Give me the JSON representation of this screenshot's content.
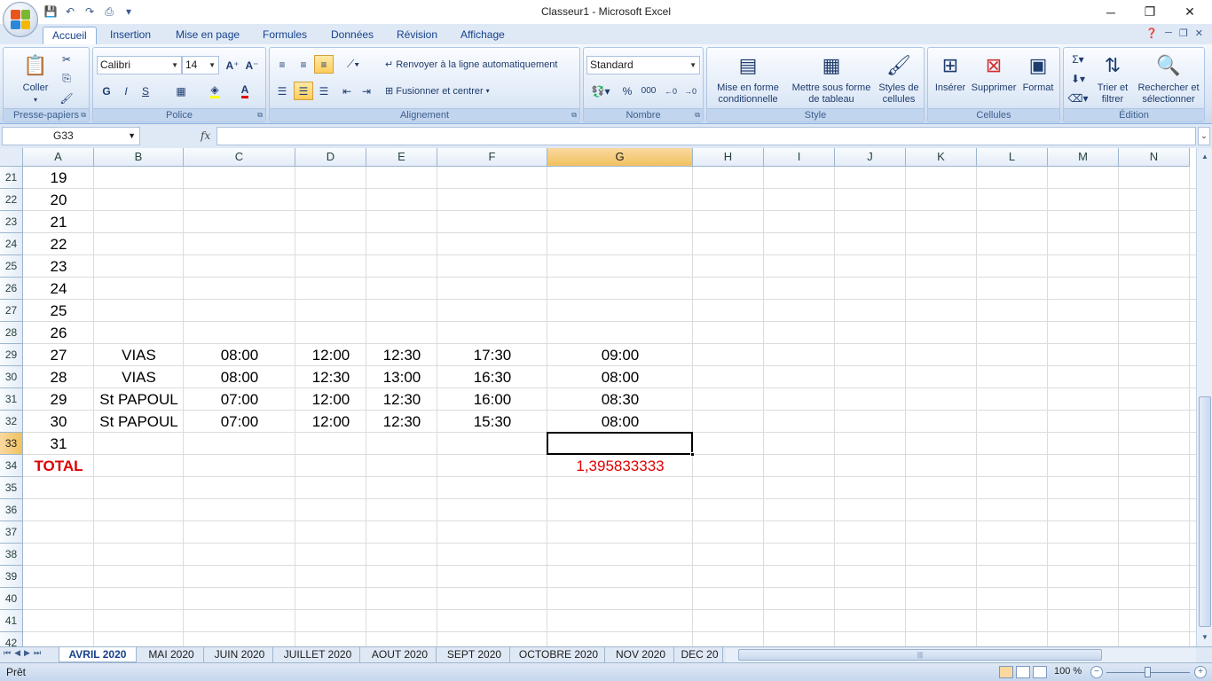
{
  "window": {
    "title": "Classeur1 - Microsoft Excel",
    "minimize": "─",
    "restore": "❐",
    "close": "✕"
  },
  "qat": {
    "icons": [
      "save-icon",
      "undo-icon",
      "redo-icon",
      "print-icon",
      "customize-icon"
    ]
  },
  "tabs": [
    "Accueil",
    "Insertion",
    "Mise en page",
    "Formules",
    "Données",
    "Révision",
    "Affichage"
  ],
  "ribbon": {
    "clipboard": {
      "label": "Presse-papiers",
      "paste": "Coller"
    },
    "font": {
      "label": "Police",
      "name": "Calibri",
      "size": "14",
      "bold": "G",
      "italic": "I",
      "underline": "S"
    },
    "alignment": {
      "label": "Alignement",
      "wrap": "Renvoyer à la ligne automatiquement",
      "merge": "Fusionner et centrer"
    },
    "number": {
      "label": "Nombre",
      "format": "Standard",
      "percent": "%",
      "thousands": "000"
    },
    "style": {
      "label": "Style",
      "conditional": "Mise en forme conditionnelle",
      "table": "Mettre sous forme de tableau",
      "cell_styles": "Styles de cellules"
    },
    "cells": {
      "label": "Cellules",
      "insert": "Insérer",
      "delete": "Supprimer",
      "format": "Format"
    },
    "editing": {
      "label": "Édition",
      "sort": "Trier et filtrer",
      "find": "Rechercher et sélectionner"
    }
  },
  "formula_bar": {
    "name_box": "G33",
    "fx": "fx",
    "formula": ""
  },
  "columns": [
    "A",
    "B",
    "C",
    "D",
    "E",
    "F",
    "G",
    "H",
    "I",
    "J",
    "K",
    "L",
    "M",
    "N"
  ],
  "selected_column": "G",
  "selected_row": "33",
  "rows": [
    {
      "n": "21",
      "A": "19"
    },
    {
      "n": "22",
      "A": "20"
    },
    {
      "n": "23",
      "A": "21"
    },
    {
      "n": "24",
      "A": "22"
    },
    {
      "n": "25",
      "A": "23"
    },
    {
      "n": "26",
      "A": "24"
    },
    {
      "n": "27",
      "A": "25"
    },
    {
      "n": "28",
      "A": "26"
    },
    {
      "n": "29",
      "A": "27",
      "B": "VIAS",
      "C": "08:00",
      "D": "12:00",
      "E": "12:30",
      "F": "17:30",
      "G": "09:00"
    },
    {
      "n": "30",
      "A": "28",
      "B": "VIAS",
      "C": "08:00",
      "D": "12:30",
      "E": "13:00",
      "F": "16:30",
      "G": "08:00"
    },
    {
      "n": "31",
      "A": "29",
      "B": "St PAPOUL",
      "C": "07:00",
      "D": "12:00",
      "E": "12:30",
      "F": "16:00",
      "G": "08:30"
    },
    {
      "n": "32",
      "A": "30",
      "B": "St PAPOUL",
      "C": "07:00",
      "D": "12:00",
      "E": "12:30",
      "F": "15:30",
      "G": "08:00"
    },
    {
      "n": "33",
      "A": "31"
    },
    {
      "n": "34",
      "A": "TOTAL",
      "G": "1,395833333"
    },
    {
      "n": "35"
    },
    {
      "n": "36"
    },
    {
      "n": "37"
    },
    {
      "n": "38"
    },
    {
      "n": "39"
    },
    {
      "n": "40"
    },
    {
      "n": "41"
    },
    {
      "n": "42"
    }
  ],
  "sheets": [
    "AVRIL 2020",
    "MAI 2020",
    "JUIN 2020",
    "JUILLET 2020",
    "AOUT 2020",
    "SEPT 2020",
    "OCTOBRE 2020",
    "NOV 2020",
    "DEC 20"
  ],
  "active_sheet": "AVRIL 2020",
  "status": {
    "ready": "Prêt",
    "zoom": "100 %"
  },
  "colors": {
    "accent": "#15428b",
    "total_red": "#e00000",
    "selected_header": "#f1c15f"
  }
}
